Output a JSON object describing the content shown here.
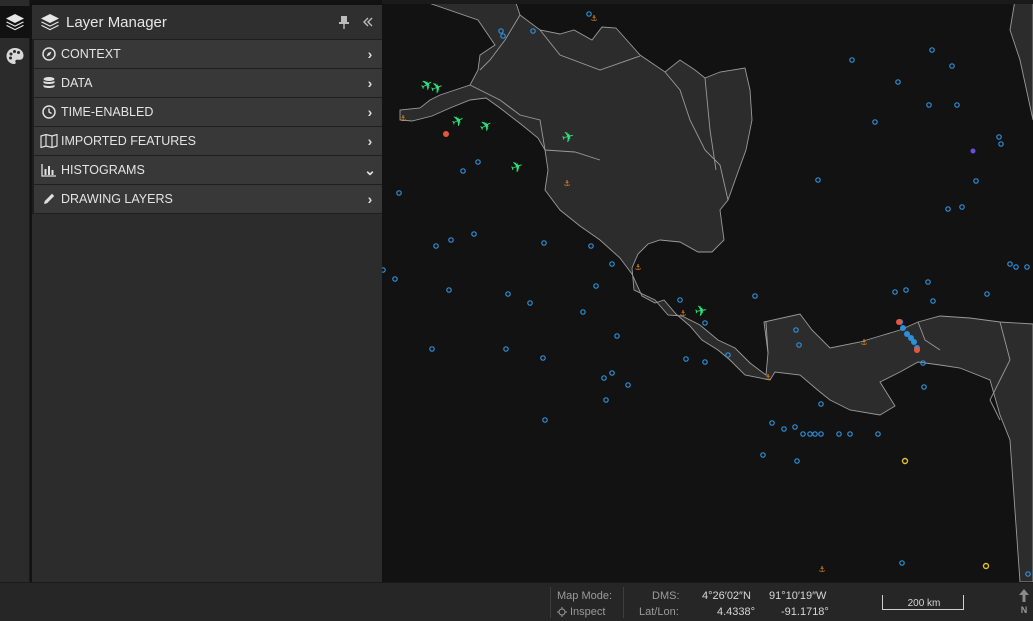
{
  "panel": {
    "title": "Layer Manager",
    "rows": [
      {
        "label": "CONTEXT",
        "icon": "compass-icon",
        "state": "collapsed"
      },
      {
        "label": "DATA",
        "icon": "database-icon",
        "state": "collapsed"
      },
      {
        "label": "TIME-ENABLED",
        "icon": "clock-icon",
        "state": "collapsed"
      },
      {
        "label": "IMPORTED FEATURES",
        "icon": "map-icon",
        "state": "collapsed"
      },
      {
        "label": "HISTOGRAMS",
        "icon": "bar-chart-icon",
        "state": "expanded"
      },
      {
        "label": "DRAWING LAYERS",
        "icon": "pencil-icon",
        "state": "collapsed"
      }
    ]
  },
  "rail": {
    "items": [
      {
        "icon": "layers-icon",
        "active": true
      },
      {
        "icon": "palette-icon",
        "active": false
      }
    ]
  },
  "status": {
    "map_mode_label": "Map Mode:",
    "map_mode_value": "Inspect",
    "dms_label": "DMS:",
    "dms_lat": "4°26′02″N",
    "dms_lon": "91°10′19″W",
    "latlon_label": "Lat/Lon:",
    "lat": "4.4338°",
    "lon": "-91.1718°",
    "scale": "200 km",
    "north": "N"
  },
  "colors": {
    "background": "#121212",
    "land": "#2c2c2c",
    "coast": "#9a9a9a",
    "vessel": "#2f8fd8",
    "aircraft": "#2ee07a",
    "port": "#e8553f",
    "anchor": "#e08a2a",
    "highlight": "#e0c030",
    "purple": "#6a4de0"
  },
  "map_markers": {
    "vessel_count_note": "",
    "legend": []
  }
}
